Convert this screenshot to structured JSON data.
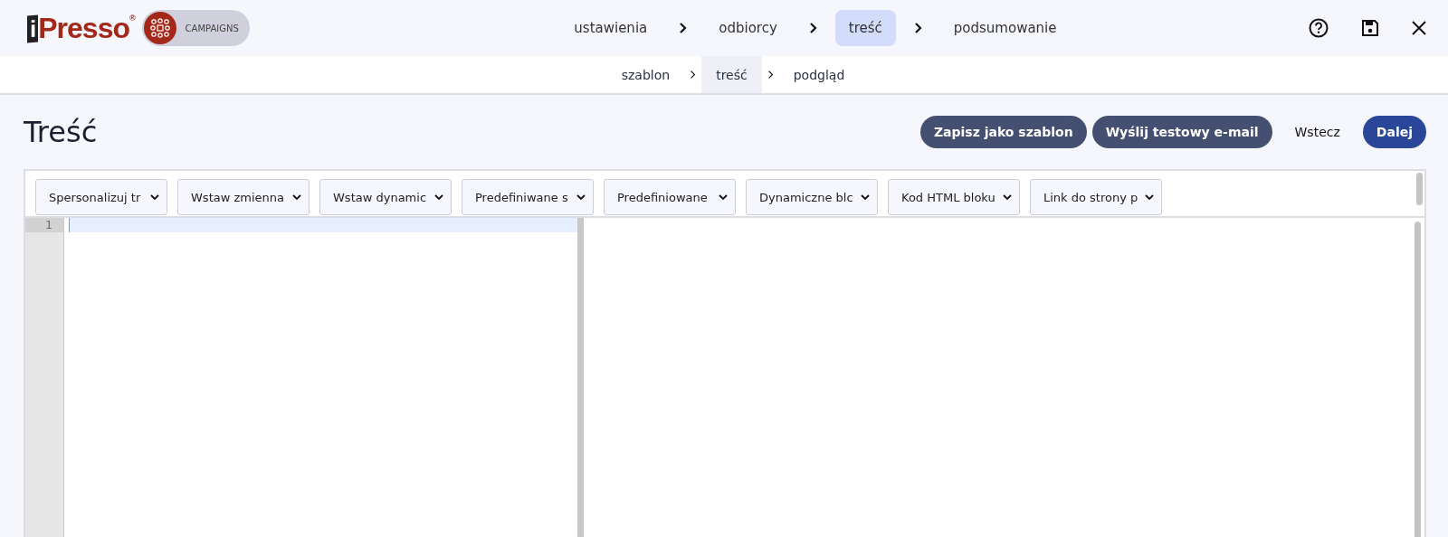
{
  "logo": {
    "letter": "i",
    "word": "Presso",
    "mark": "®"
  },
  "module_badge": {
    "label": "CAMPAIGNS"
  },
  "steps": [
    {
      "label": "ustawienia",
      "selected": false
    },
    {
      "label": "odbiorcy",
      "selected": false
    },
    {
      "label": "treść",
      "selected": true
    },
    {
      "label": "podsumowanie",
      "selected": false
    }
  ],
  "substeps": [
    {
      "label": "szablon",
      "selected": false
    },
    {
      "label": "treść",
      "selected": true
    },
    {
      "label": "podgląd",
      "selected": false
    }
  ],
  "page_title": "Treść",
  "actions": [
    {
      "label": "Zapisz jako szablon",
      "kind": "secondary"
    },
    {
      "label": "Wyślij testowy e-mail",
      "kind": "secondary"
    },
    {
      "label": "Wstecz",
      "kind": "text"
    },
    {
      "label": "Dalej",
      "kind": "primary"
    }
  ],
  "dropdowns": [
    {
      "label": "Spersonalizuj tr"
    },
    {
      "label": "Wstaw zmienna"
    },
    {
      "label": "Wstaw dynamic"
    },
    {
      "label": "Predefiniwane s"
    },
    {
      "label": "Predefiniowane"
    },
    {
      "label": "Dynamiczne blc"
    },
    {
      "label": "Kod HTML bloku"
    },
    {
      "label": "Link do strony p"
    }
  ],
  "editor": {
    "line_numbers": [
      "1"
    ]
  }
}
